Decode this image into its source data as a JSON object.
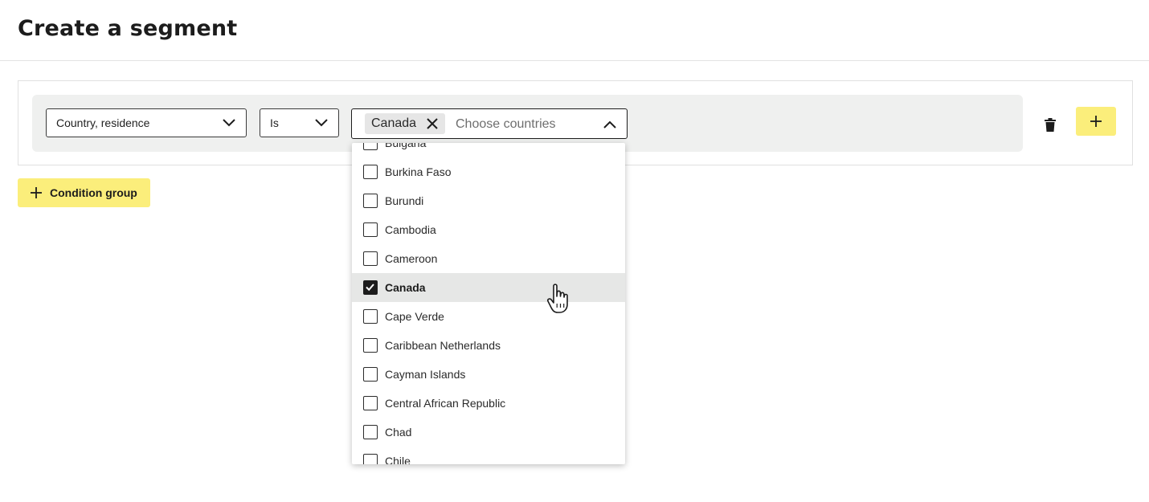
{
  "page": {
    "title": "Create a segment"
  },
  "condition": {
    "attribute_value": "Country, residence",
    "operator_value": "Is",
    "countries": {
      "chip_label": "Canada",
      "placeholder": "Choose countries"
    }
  },
  "buttons": {
    "condition_group_label": "Condition group"
  },
  "dropdown": {
    "options": [
      {
        "label": "Bulgaria",
        "checked": false
      },
      {
        "label": "Burkina Faso",
        "checked": false
      },
      {
        "label": "Burundi",
        "checked": false
      },
      {
        "label": "Cambodia",
        "checked": false
      },
      {
        "label": "Cameroon",
        "checked": false
      },
      {
        "label": "Canada",
        "checked": true
      },
      {
        "label": "Cape Verde",
        "checked": false
      },
      {
        "label": "Caribbean Netherlands",
        "checked": false
      },
      {
        "label": "Cayman Islands",
        "checked": false
      },
      {
        "label": "Central African Republic",
        "checked": false
      },
      {
        "label": "Chad",
        "checked": false
      },
      {
        "label": "Chile",
        "checked": false
      }
    ]
  },
  "icons": {
    "chevron": "chevron-down-icon",
    "chevron_up": "chevron-up-icon",
    "remove": "close-icon",
    "delete": "trash-icon",
    "add": "plus-icon",
    "cursor": "hand-pointer-icon"
  },
  "colors": {
    "accent_yellow": "#fbee7b",
    "row_background": "#eff0ef",
    "checkbox_checked": "#1c1c1c"
  }
}
